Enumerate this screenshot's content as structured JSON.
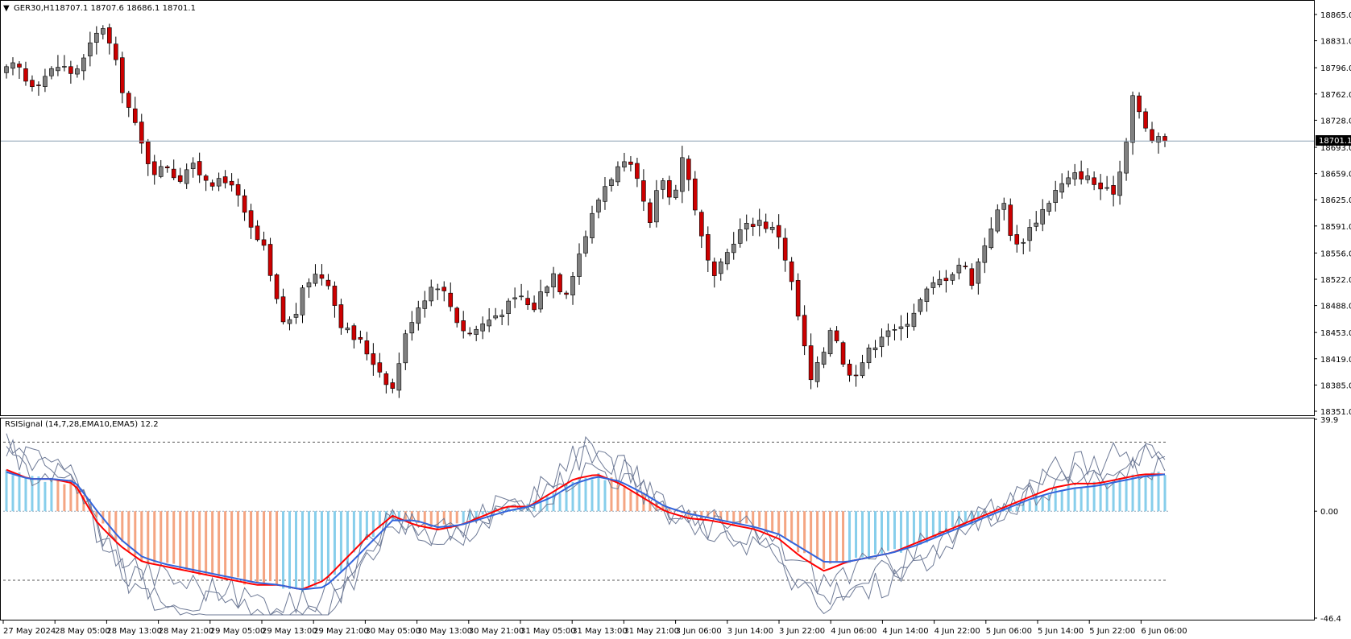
{
  "main_pane": {
    "symbol_label": "GER30,H1",
    "ohlc_text": "18707.1 18707.6 18686.1 18701.1",
    "current_price_label": "18701.1"
  },
  "indicator_pane": {
    "label": "RSISignal (14,7,28,EMA10,EMA5) 12.2"
  },
  "colors": {
    "bull_candle": "#808080",
    "bear_candle": "#cc0000",
    "price_line": "#8ca0b4",
    "fast_line": "#ff0000",
    "slow_line": "#3264dc",
    "hist_up": "#87ceeb",
    "hist_down": "#f4a582",
    "thin_lines": "#6e7a96"
  },
  "chart_data": [
    {
      "type": "candlestick",
      "title": "GER30,H1",
      "ylim": [
        18351.0,
        18865.0
      ],
      "y_ticks": [
        "18865.0",
        "18831.0",
        "18796.0",
        "18762.0",
        "18728.0",
        "18693.0",
        "18659.0",
        "18625.0",
        "18591.0",
        "18556.0",
        "18522.0",
        "18488.0",
        "18453.0",
        "18419.0",
        "18385.0",
        "18351.0"
      ],
      "x_ticks": [
        "27 May 2024",
        "28 May 05:00",
        "28 May 13:00",
        "28 May 21:00",
        "29 May 05:00",
        "29 May 13:00",
        "29 May 21:00",
        "30 May 05:00",
        "30 May 13:00",
        "30 May 21:00",
        "31 May 05:00",
        "31 May 13:00",
        "31 May 21:00",
        "3 Jun 06:00",
        "3 Jun 14:00",
        "3 Jun 22:00",
        "4 Jun 06:00",
        "4 Jun 14:00",
        "4 Jun 22:00",
        "5 Jun 06:00",
        "5 Jun 14:00",
        "5 Jun 22:00",
        "6 Jun 06:00"
      ],
      "current_price": 18701.1,
      "close_path": [
        18792,
        18800,
        18775,
        18780,
        18790,
        18800,
        18790,
        18800,
        18830,
        18850,
        18810,
        18760,
        18720,
        18680,
        18660,
        18670,
        18650,
        18670,
        18660,
        18650,
        18645,
        18650,
        18610,
        18580,
        18560,
        18500,
        18460,
        18480,
        18520,
        18530,
        18520,
        18470,
        18450,
        18440,
        18420,
        18400,
        18380,
        18440,
        18480,
        18500,
        18520,
        18500,
        18470,
        18450,
        18460,
        18470,
        18480,
        18490,
        18500,
        18480,
        18510,
        18530,
        18500,
        18540,
        18580,
        18620,
        18650,
        18665,
        18670,
        18640,
        18590,
        18660,
        18620,
        18680,
        18630,
        18560,
        18520,
        18550,
        18580,
        18590,
        18600,
        18590,
        18580,
        18530,
        18460,
        18390,
        18420,
        18470,
        18410,
        18400,
        18420,
        18440,
        18460,
        18450,
        18470,
        18490,
        18510,
        18520,
        18530,
        18545,
        18520,
        18560,
        18600,
        18620,
        18560,
        18580,
        18600,
        18620,
        18640,
        18650,
        18660,
        18650,
        18640,
        18630,
        18670,
        18760,
        18720,
        18700,
        18701.1
      ],
      "candle_count": 181
    },
    {
      "type": "line",
      "title": "RSISignal (14,7,28,EMA10,EMA5) 12.2",
      "ylim": [
        -46.4,
        39.9
      ],
      "y_ticks": [
        "39.9",
        "0.00",
        "-46.4"
      ],
      "levels": [
        30,
        -30
      ],
      "fast_path": [
        18,
        14,
        14,
        12,
        -5,
        -15,
        -22,
        -24,
        -26,
        -28,
        -30,
        -32,
        -32,
        -34,
        -30,
        -20,
        -10,
        -2,
        -6,
        -8,
        -6,
        -2,
        2,
        2,
        8,
        14,
        16,
        12,
        6,
        0,
        -3,
        -4,
        -6,
        -8,
        -12,
        -20,
        -26,
        -22,
        -20,
        -18,
        -14,
        -10,
        -6,
        -2,
        2,
        6,
        10,
        12,
        12,
        14,
        16,
        16
      ],
      "slow_path": [
        17,
        14,
        14,
        13,
        0,
        -12,
        -20,
        -23,
        -25,
        -27,
        -29,
        -31,
        -32,
        -34,
        -33,
        -24,
        -14,
        -4,
        -4,
        -7,
        -6,
        -3,
        0,
        2,
        6,
        12,
        15,
        13,
        8,
        2,
        -1,
        -3,
        -5,
        -7,
        -10,
        -16,
        -22,
        -22,
        -20,
        -18,
        -15,
        -11,
        -7,
        -3,
        1,
        5,
        8,
        10,
        11,
        13,
        15,
        16
      ],
      "histogram_range": [
        -30,
        28
      ]
    }
  ]
}
